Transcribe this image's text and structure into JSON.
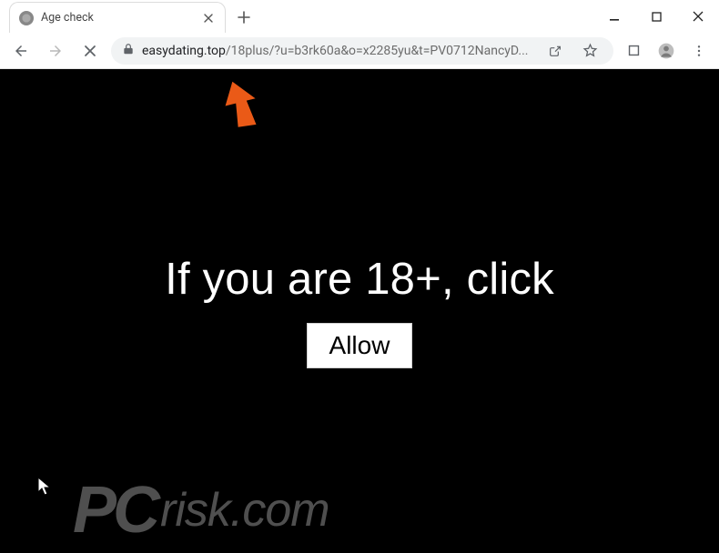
{
  "tab": {
    "title": "Age check"
  },
  "omnibox": {
    "host": "easydating.top",
    "path": "/18plus/?u=b3rk60a&o=x2285yu&t=PV0712NancyD..."
  },
  "page": {
    "headline": "If you are 18+, click",
    "allow_label": "Allow"
  },
  "watermark": {
    "brand_pc": "PC",
    "brand_rest": "risk.com"
  }
}
